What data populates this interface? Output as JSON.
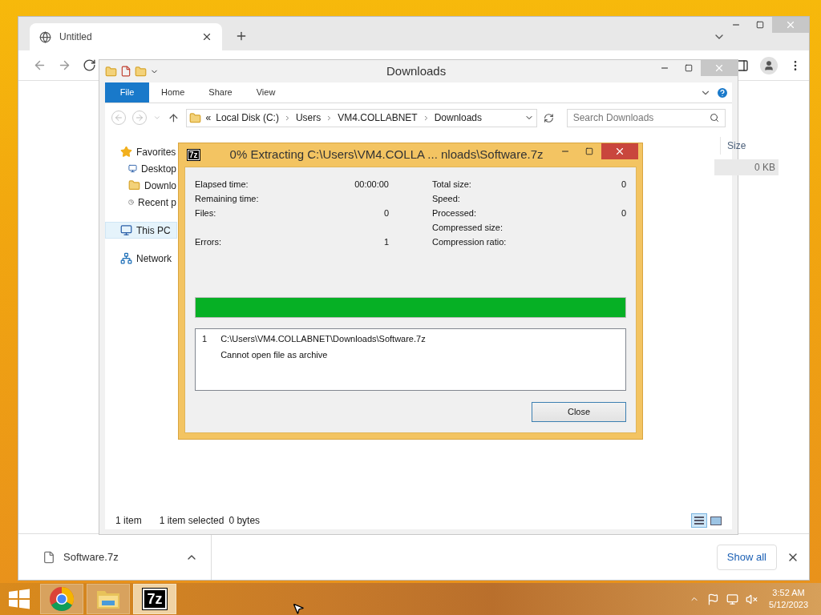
{
  "browser": {
    "tab_title": "Untitled",
    "download_file": "Software.7z",
    "show_all": "Show all"
  },
  "explorer": {
    "title": "Downloads",
    "ribbon_tabs": [
      {
        "label": "File",
        "selected": true
      },
      {
        "label": "Home",
        "selected": false
      },
      {
        "label": "Share",
        "selected": false
      },
      {
        "label": "View",
        "selected": false
      }
    ],
    "path_prefix": "«",
    "path": [
      "Local Disk (C:)",
      "Users",
      "VM4.COLLABNET",
      "Downloads"
    ],
    "search_placeholder": "Search Downloads",
    "nav": [
      {
        "label": "Favorites",
        "kind": "star",
        "selected": false,
        "children": [
          {
            "label": "Desktop",
            "kind": "desktop",
            "selected": false
          },
          {
            "label": "Downlo",
            "kind": "downloads",
            "selected": false
          },
          {
            "label": "Recent p",
            "kind": "recent",
            "selected": false
          }
        ]
      },
      {
        "label": "This PC",
        "kind": "pc",
        "selected": true
      },
      {
        "label": "Network",
        "kind": "network",
        "selected": false
      }
    ],
    "size_column": "Size",
    "row_size": "0 KB",
    "status": [
      "1 item",
      "1 item selected",
      "0 bytes"
    ]
  },
  "dialog": {
    "icon_label": "7z",
    "title": "0% Extracting C:\\Users\\VM4.COLLA ... nloads\\Software.7z",
    "stat_rows": [
      {
        "left": {
          "label": "Elapsed time:",
          "value": "00:00:00"
        },
        "right": {
          "label": "Total size:",
          "value": "0"
        }
      },
      {
        "left": {
          "label": "Remaining time:"
        },
        "right": {
          "label": "Speed:"
        }
      },
      {
        "left": {
          "label": "Files:",
          "value": "0"
        },
        "right": {
          "label": "Processed:",
          "value": "0"
        }
      },
      {
        "right": {
          "label": "Compressed size:"
        }
      },
      {
        "left": {
          "label": "Errors:",
          "value": "1"
        },
        "right": {
          "label": "Compression ratio:"
        }
      }
    ],
    "progress": {
      "level": 1
    },
    "log": [
      {
        "index": "1",
        "path": "C:\\Users\\VM4.COLLABNET\\Downloads\\Software.7z",
        "message": "Cannot open file as archive"
      }
    ],
    "close": "Close"
  },
  "taskbar": {
    "apps": [
      {
        "kind": "chrome",
        "active": false
      },
      {
        "kind": "explorer",
        "active": false
      },
      {
        "kind": "sevenzip",
        "label": "7z",
        "active": true
      }
    ],
    "time": "3:52 AM",
    "date": "5/12/2023"
  }
}
